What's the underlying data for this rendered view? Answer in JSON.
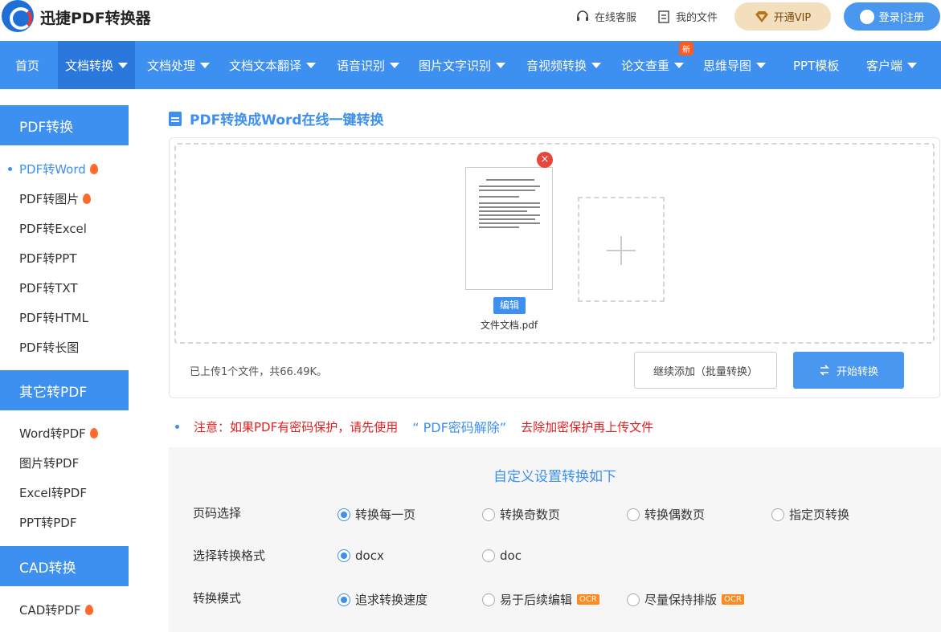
{
  "brand": {
    "name": "迅捷PDF转换器"
  },
  "top_links": {
    "service": "在线客服",
    "files": "我的文件",
    "vip": "开通VIP",
    "login": "登录|注册"
  },
  "nav": {
    "items": [
      "首页",
      "文档转换",
      "文档处理",
      "文档文本翻译",
      "语音识别",
      "图片文字识别",
      "音视频转换",
      "论文查重",
      "思维导图",
      "PPT模板",
      "客户端"
    ],
    "new_badge": "新"
  },
  "sidebar": {
    "groups": [
      {
        "title": "PDF转换",
        "items": [
          "PDF转Word",
          "PDF转图片",
          "PDF转Excel",
          "PDF转PPT",
          "PDF转TXT",
          "PDF转HTML",
          "PDF转长图"
        ]
      },
      {
        "title": "其它转PDF",
        "items": [
          "Word转PDF",
          "图片转PDF",
          "Excel转PDF",
          "PPT转PDF"
        ]
      },
      {
        "title": "CAD转换",
        "items": [
          "CAD转PDF"
        ]
      }
    ]
  },
  "main": {
    "title": "PDF转换成Word在线一键转换",
    "file": {
      "name": "文件文档.pdf",
      "edit_label": "编辑"
    },
    "upload_info": "已上传1个文件，共66.49K。",
    "add_more_label": "继续添加（批量转换）",
    "start_label": "开始转换",
    "notice": {
      "prefix": "注意：如果PDF有密码保护，请先使用",
      "link": "“ PDF密码解除”",
      "suffix": "去除加密保护再上传文件"
    }
  },
  "settings": {
    "title": "自定义设置转换如下",
    "page": {
      "label": "页码选择",
      "options": [
        "转换每一页",
        "转换奇数页",
        "转换偶数页",
        "指定页转换"
      ],
      "selected": 0
    },
    "format": {
      "label": "选择转换格式",
      "options": [
        "docx",
        "doc"
      ],
      "selected": 0
    },
    "mode": {
      "label": "转换模式",
      "options": [
        "追求转换速度",
        "易于后续编辑",
        "尽量保持排版"
      ],
      "selected": 0,
      "ocr_badge": "OCR"
    }
  }
}
